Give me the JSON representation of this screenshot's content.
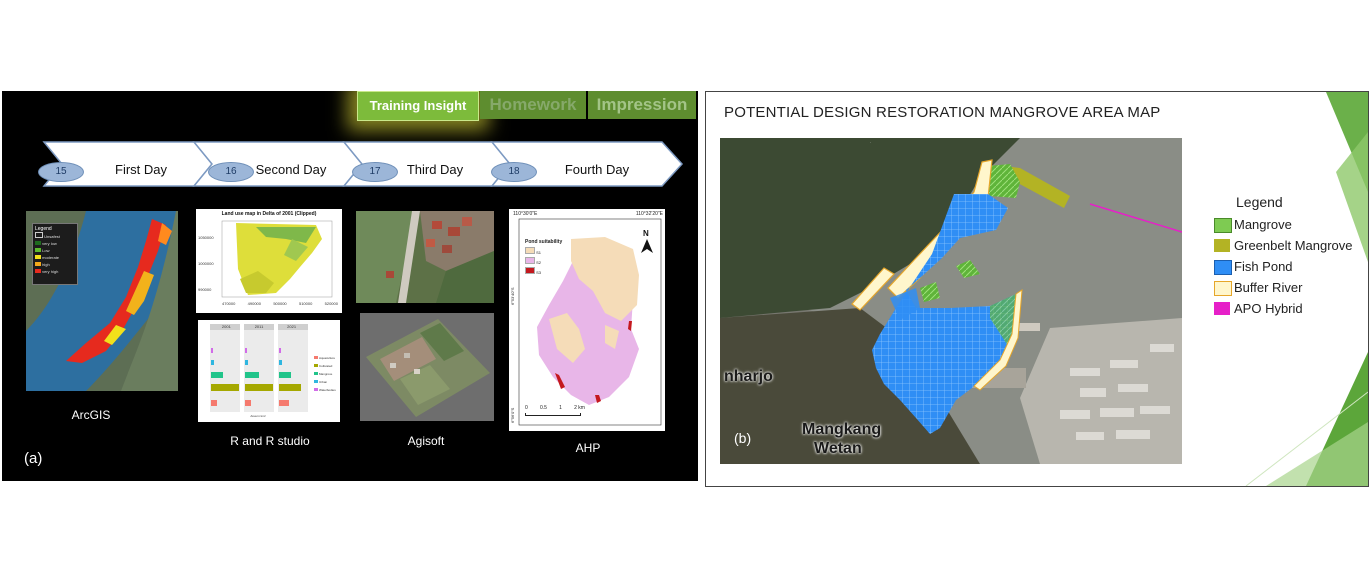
{
  "panel_a": {
    "label": "(a)",
    "tabs": [
      {
        "label": "Training Insight",
        "active": true
      },
      {
        "label": "Homework",
        "active": false
      },
      {
        "label": "Impression",
        "active": false
      }
    ],
    "days": [
      {
        "number": "15",
        "label": "First Day"
      },
      {
        "number": "16",
        "label": "Second Day"
      },
      {
        "number": "17",
        "label": "Third Day"
      },
      {
        "number": "18",
        "label": "Fourth Day"
      }
    ],
    "thumbnails": {
      "arcgis": {
        "caption": "ArcGIS",
        "legend_title": "Legend",
        "legend_items": [
          "Unsafest",
          "very low",
          "Low",
          "moderate",
          "high",
          "very high"
        ]
      },
      "r_studio": {
        "caption": "R and R studio",
        "map_title": "Land use map in Delta of 2001 (Clipped)",
        "x_ticks": [
          "470000",
          "490000",
          "500000",
          "510000",
          "520000"
        ],
        "y_ticks": [
          "1050000",
          "1000000",
          "990000"
        ],
        "facet_labels": [
          "2001",
          "2011",
          "2021"
        ],
        "bar_legend": [
          "Aquaculture",
          "Cultivated",
          "Mangrove",
          "Urban",
          "Waterbodies"
        ],
        "bar_xlabel": "Area in km²"
      },
      "agisoft": {
        "caption": "Agisoft"
      },
      "ahp": {
        "caption": "AHP",
        "top_coords": [
          "110°30'0\"E",
          "110°32'20\"E"
        ],
        "side_coords": [
          "6°53'40\"S",
          "6°56'0\"S"
        ],
        "legend_title": "Pond suitability",
        "legend_items": [
          "S1",
          "S2",
          "S3"
        ],
        "north": "N",
        "scale_ticks": [
          "0",
          "0.5",
          "1",
          "2 km"
        ]
      }
    }
  },
  "panel_b": {
    "label": "(b)",
    "title": "POTENTIAL DESIGN RESTORATION MANGROVE AREA MAP",
    "legend_title": "Legend",
    "legend": [
      {
        "label": "Mangrove",
        "color": "#7ecb52"
      },
      {
        "label": "Greenbelt Mangrove",
        "color": "#b3b324"
      },
      {
        "label": "Fish Pond",
        "color": "#2f8ef5"
      },
      {
        "label": "Buffer River",
        "color": "#fff6cc"
      },
      {
        "label": "APO Hybrid",
        "color": "#e620c8"
      }
    ],
    "places": [
      "nharjo",
      "Mangkang",
      "Wetan"
    ]
  }
}
